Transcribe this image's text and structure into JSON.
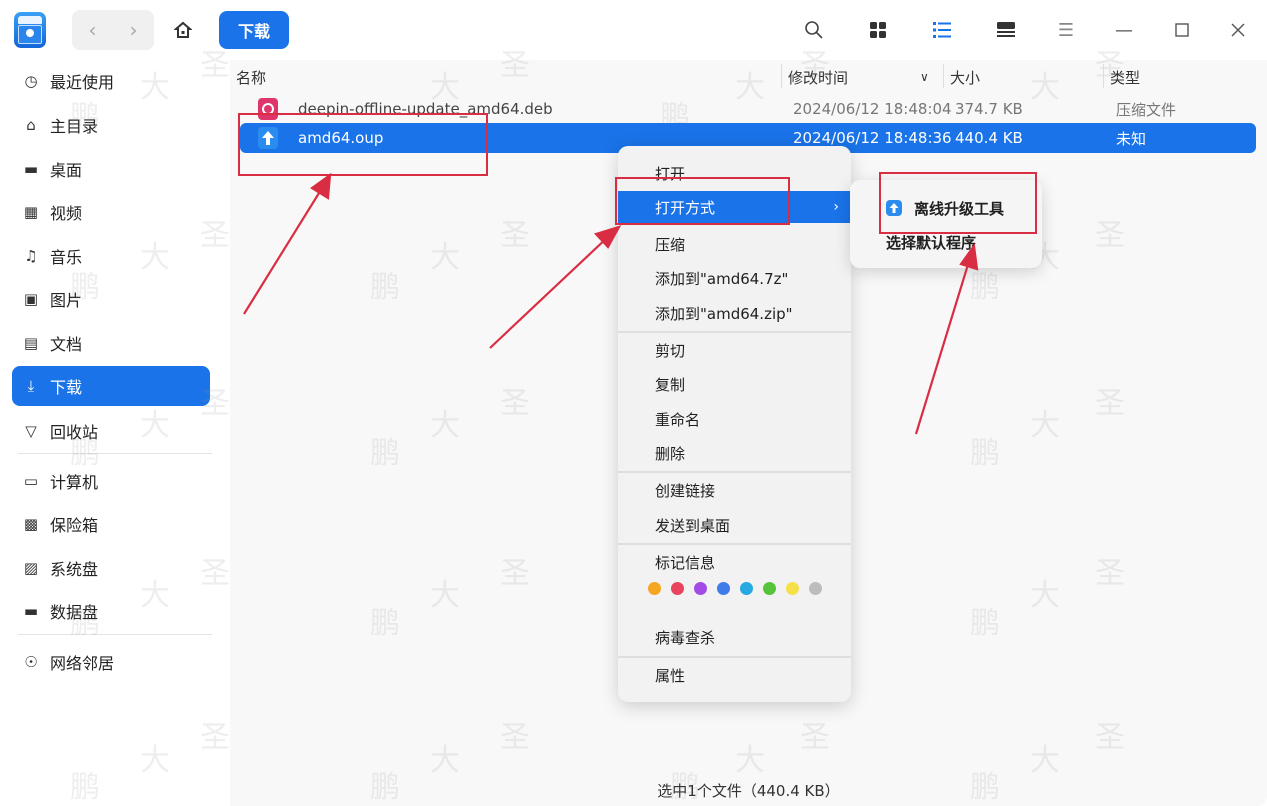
{
  "titlebar": {
    "app_icon": "file-manager-icon",
    "back_icon": "chevron-left-icon",
    "forward_icon": "chevron-right-icon",
    "home_icon": "home-icon",
    "breadcrumb": "下载",
    "tools": [
      "search-icon",
      "icon-view-icon",
      "list-view-icon",
      "tree-view-icon",
      "menu-icon",
      "minimize-icon",
      "maximize-icon",
      "close-icon"
    ]
  },
  "sidebar": {
    "items": [
      {
        "label": "最近使用",
        "icon": "recent-icon"
      },
      {
        "label": "主目录",
        "icon": "home-icon"
      },
      {
        "label": "桌面",
        "icon": "desktop-icon"
      },
      {
        "label": "视频",
        "icon": "video-icon"
      },
      {
        "label": "音乐",
        "icon": "music-icon"
      },
      {
        "label": "图片",
        "icon": "picture-icon"
      },
      {
        "label": "文档",
        "icon": "document-icon"
      },
      {
        "label": "下载",
        "icon": "download-icon"
      },
      {
        "label": "回收站",
        "icon": "trash-icon"
      },
      {
        "label": "计算机",
        "icon": "computer-icon"
      },
      {
        "label": "保险箱",
        "icon": "vault-icon"
      },
      {
        "label": "系统盘",
        "icon": "system-disk-icon"
      },
      {
        "label": "数据盘",
        "icon": "data-disk-icon"
      },
      {
        "label": "网络邻居",
        "icon": "network-icon"
      }
    ]
  },
  "columns": {
    "name": "名称",
    "modified": "修改时间",
    "size": "大小",
    "type": "类型"
  },
  "files": [
    {
      "name": "deepin-offline-update_amd64.deb",
      "modified": "2024/06/12 18:48:04",
      "size": "374.7 KB",
      "type": "压缩文件"
    },
    {
      "name": "amd64.oup",
      "modified": "2024/06/12 18:48:36",
      "size": "440.4 KB",
      "type": "未知"
    }
  ],
  "context_menu": {
    "open": "打开",
    "open_with": "打开方式",
    "compress": "压缩",
    "add_7z": "添加到\"amd64.7z\"",
    "add_zip": "添加到\"amd64.zip\"",
    "cut": "剪切",
    "copy": "复制",
    "rename": "重命名",
    "delete": "删除",
    "create_link": "创建链接",
    "send_desktop": "发送到桌面",
    "tag_info": "标记信息",
    "tag_colors": [
      "#f5a623",
      "#e9435e",
      "#a34be6",
      "#3f7be9",
      "#27a9e1",
      "#55c43b",
      "#f5e04a",
      "#bdbdbd"
    ],
    "virus_scan": "病毒查杀",
    "properties": "属性"
  },
  "submenu": {
    "offline_tool": "离线升级工具",
    "choose_default": "选择默认程序"
  },
  "status": {
    "text": "选中1个文件（440.4 KB）"
  },
  "watermark": [
    "鹏",
    "大",
    "圣"
  ]
}
